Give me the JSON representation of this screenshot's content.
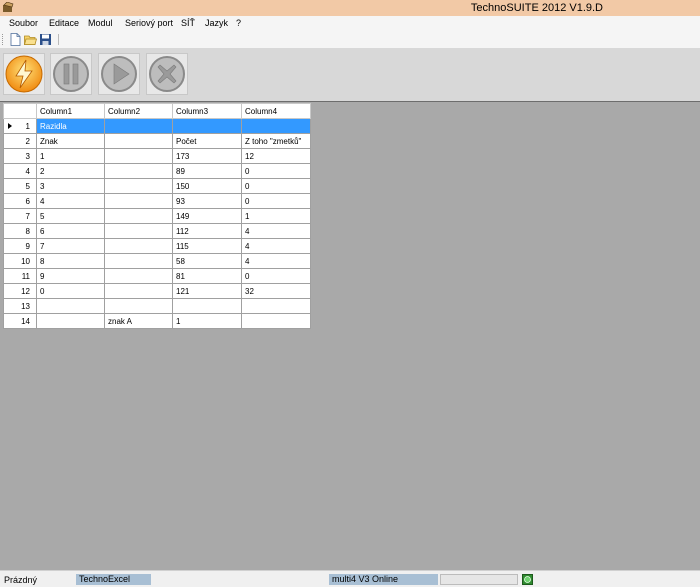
{
  "window": {
    "title": "TechnoSUITE 2012 V1.9.D"
  },
  "menu": [
    "Soubor",
    "Editace",
    "Modul",
    "Seriový port",
    "SÍŤ",
    "Jazyk",
    "?"
  ],
  "toolbar": {
    "icons": [
      "new-file-icon",
      "open-folder-icon",
      "save-icon"
    ]
  },
  "actions": [
    {
      "name": "start-button",
      "icon": "lightning-icon",
      "color": "#f5a623"
    },
    {
      "name": "pause-button",
      "icon": "pause-icon",
      "color": "#b8b8b8"
    },
    {
      "name": "play-button",
      "icon": "play-icon",
      "color": "#b8b8b8"
    },
    {
      "name": "stop-button",
      "icon": "close-icon",
      "color": "#b8b8b8"
    }
  ],
  "grid": {
    "columns": [
      "Column1",
      "Column2",
      "Column3",
      "Column4"
    ],
    "selected_row": 1,
    "rows": [
      {
        "num": "1",
        "cells": [
          "Razidla",
          "",
          "",
          ""
        ]
      },
      {
        "num": "2",
        "cells": [
          "Znak",
          "",
          "Počet",
          "Z toho \"zmetků\""
        ]
      },
      {
        "num": "3",
        "cells": [
          "1",
          "",
          "173",
          "12"
        ]
      },
      {
        "num": "4",
        "cells": [
          "2",
          "",
          "89",
          "0"
        ]
      },
      {
        "num": "5",
        "cells": [
          "3",
          "",
          "150",
          "0"
        ]
      },
      {
        "num": "6",
        "cells": [
          "4",
          "",
          "93",
          "0"
        ]
      },
      {
        "num": "7",
        "cells": [
          "5",
          "",
          "149",
          "1"
        ]
      },
      {
        "num": "8",
        "cells": [
          "6",
          "",
          "112",
          "4"
        ]
      },
      {
        "num": "9",
        "cells": [
          "7",
          "",
          "115",
          "4"
        ]
      },
      {
        "num": "10",
        "cells": [
          "8",
          "",
          "58",
          "4"
        ]
      },
      {
        "num": "11",
        "cells": [
          "9",
          "",
          "81",
          "0"
        ]
      },
      {
        "num": "12",
        "cells": [
          "0",
          "",
          "121",
          "32"
        ]
      },
      {
        "num": "13",
        "cells": [
          "",
          "",
          "",
          ""
        ]
      },
      {
        "num": "14",
        "cells": [
          "",
          "znak A",
          "1",
          ""
        ]
      }
    ]
  },
  "status": {
    "left": "Prázdný",
    "module": "TechnoExcel",
    "connection": "multi4 V3 Online",
    "progress": 0,
    "indicator_icon": "online-indicator-icon"
  }
}
